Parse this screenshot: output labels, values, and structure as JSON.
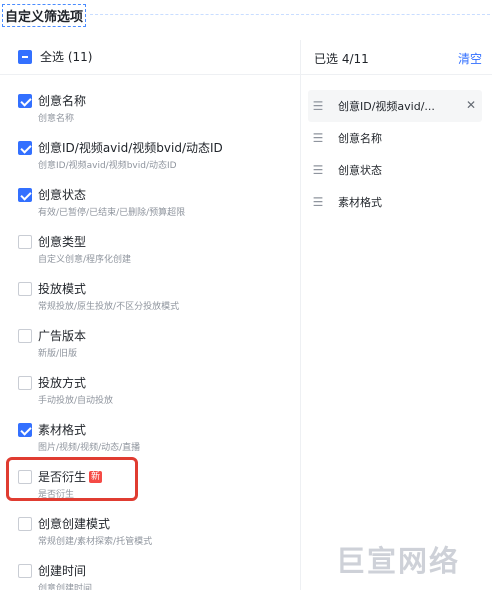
{
  "title": "自定义筛选项",
  "header": {
    "select_all_label": "全选 (11)",
    "selected_count": "已选 4/11",
    "clear_label": "清空"
  },
  "options": [
    {
      "label": "创意名称",
      "desc": "创意名称",
      "checked": true
    },
    {
      "label": "创意ID/视频avid/视频bvid/动态ID",
      "desc": "创意ID/视频avid/视频bvid/动态ID",
      "checked": true
    },
    {
      "label": "创意状态",
      "desc": "有效/已暂停/已结束/已删除/预算超限",
      "checked": true
    },
    {
      "label": "创意类型",
      "desc": "自定义创意/程序化创建",
      "checked": false
    },
    {
      "label": "投放模式",
      "desc": "常规投放/原生投放/不区分投放模式",
      "checked": false
    },
    {
      "label": "广告版本",
      "desc": "新版/旧版",
      "checked": false
    },
    {
      "label": "投放方式",
      "desc": "手动投放/自动投放",
      "checked": false
    },
    {
      "label": "素材格式",
      "desc": "图片/视频/视频/动态/直播",
      "checked": true
    },
    {
      "label": "是否衍生",
      "desc": "是否衍生",
      "checked": false,
      "badge": "新"
    },
    {
      "label": "创意创建模式",
      "desc": "常规创建/素材探索/托管模式",
      "checked": false
    },
    {
      "label": "创建时间",
      "desc": "创意创建时间",
      "checked": false
    }
  ],
  "selected": [
    {
      "label": "创意ID/视频avid/..."
    },
    {
      "label": "创意名称"
    },
    {
      "label": "创意状态"
    },
    {
      "label": "素材格式"
    }
  ],
  "watermark": "巨宣网络"
}
